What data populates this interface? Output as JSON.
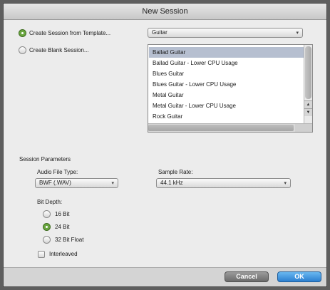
{
  "window": {
    "title": "New Session"
  },
  "options": {
    "from_template_label": "Create Session from Template...",
    "blank_label": "Create Blank Session...",
    "selected": "from_template"
  },
  "template_group": {
    "value": "Guitar"
  },
  "templates": [
    {
      "label": "Ballad Guitar",
      "selected": true
    },
    {
      "label": "Ballad Guitar - Lower CPU Usage",
      "selected": false
    },
    {
      "label": "Blues Guitar",
      "selected": false
    },
    {
      "label": "Blues Guitar - Lower CPU Usage",
      "selected": false
    },
    {
      "label": "Metal Guitar",
      "selected": false
    },
    {
      "label": "Metal Guitar - Lower CPU Usage",
      "selected": false
    },
    {
      "label": "Rock Guitar",
      "selected": false
    }
  ],
  "params": {
    "section_label": "Session Parameters",
    "audio_file_type_label": "Audio File Type:",
    "audio_file_type_value": "BWF (.WAV)",
    "sample_rate_label": "Sample Rate:",
    "sample_rate_value": "44.1 kHz",
    "bit_depth_label": "Bit Depth:",
    "bit_depths": [
      {
        "label": "16 Bit",
        "selected": false
      },
      {
        "label": "24 Bit",
        "selected": true
      },
      {
        "label": "32 Bit Float",
        "selected": false
      }
    ],
    "interleaved_label": "Interleaved",
    "interleaved_checked": false
  },
  "buttons": {
    "cancel": "Cancel",
    "ok": "OK"
  },
  "colors": {
    "accent_green": "#6aa640",
    "ok_blue": "#2b7fd0",
    "selection": "#b6bfd0"
  }
}
